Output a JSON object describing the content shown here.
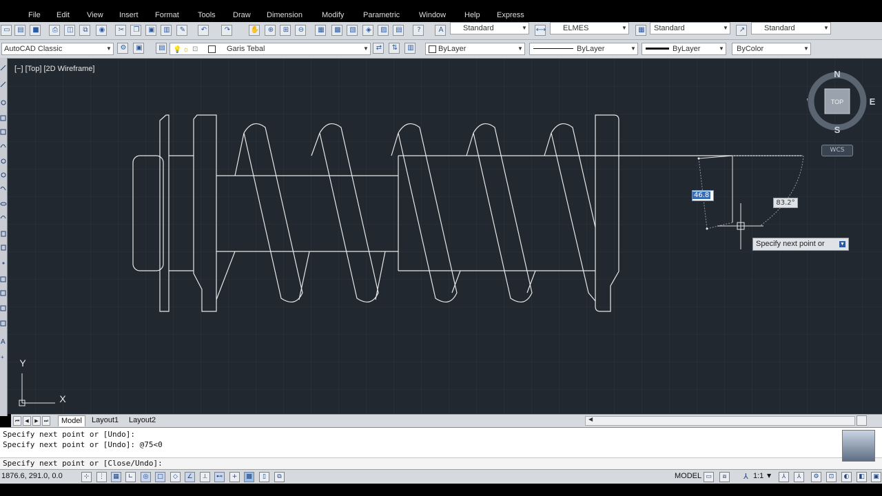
{
  "menu": [
    "File",
    "Edit",
    "View",
    "Insert",
    "Format",
    "Tools",
    "Draw",
    "Dimension",
    "Modify",
    "Parametric",
    "Window",
    "Help",
    "Express"
  ],
  "toolbar1": {
    "text_style": "Standard",
    "dim_style": "ELMES",
    "table_style": "Standard",
    "mleader_style": "Standard"
  },
  "toolbar2": {
    "workspace": "AutoCAD Classic",
    "layer": "Garis Tebal",
    "color": "ByLayer",
    "linetype": "ByLayer",
    "lineweight": "ByLayer",
    "plotstyle": "ByColor"
  },
  "viewport": {
    "label": "[−] [Top] [2D Wireframe]",
    "dyn_length": "46.8",
    "dyn_angle": "83.2°",
    "prompt_tip": "Specify next point or",
    "viewcube": {
      "top": "TOP",
      "north": "N",
      "south": "S",
      "east": "E",
      "west": "W",
      "wcs": "WCS"
    },
    "ucs": {
      "x": "X",
      "y": "Y"
    }
  },
  "tabs": [
    "Model",
    "Layout1",
    "Layout2"
  ],
  "command": {
    "history": [
      "Specify next point or [Undo]:",
      "Specify next point or [Undo]: @75<0"
    ],
    "prompt": "Specify next point or [Close/Undo]:"
  },
  "status": {
    "coords": "1876.6, 291.0, 0.0",
    "model": "MODEL",
    "scale": "1:1"
  },
  "colors": {
    "canvas": "#212830",
    "linework": "#e8e8e8",
    "toolbar": "#d6d9de"
  }
}
